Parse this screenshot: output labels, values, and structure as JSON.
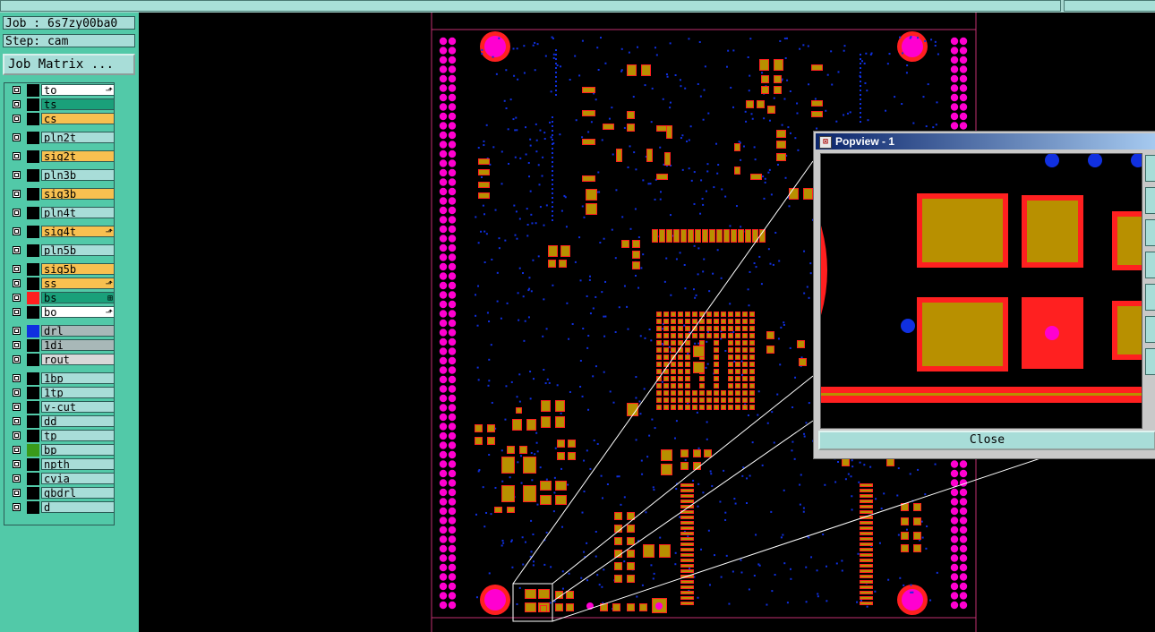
{
  "top": {
    "job": "Job : 6s7zy00ba0",
    "step": "Step: cam"
  },
  "buttons": {
    "job_matrix": "Job Matrix ..."
  },
  "layers": [
    {
      "name": "to",
      "swatch": "#000000",
      "bg": "#ffffff",
      "mark": "⬏"
    },
    {
      "name": "ts",
      "swatch": "#000000",
      "bg": "#1aa07a",
      "mark": ""
    },
    {
      "name": "cs",
      "swatch": "#000000",
      "bg": "#f8c050",
      "mark": ""
    },
    {
      "name": "pln2t",
      "swatch": "#000000",
      "bg": "#a8ddd8",
      "mark": ""
    },
    {
      "name": "sig2t",
      "swatch": "#000000",
      "bg": "#f8c050",
      "mark": ""
    },
    {
      "name": "pln3b",
      "swatch": "#000000",
      "bg": "#a8ddd8",
      "mark": ""
    },
    {
      "name": "sig3b",
      "swatch": "#000000",
      "bg": "#f8c050",
      "mark": ""
    },
    {
      "name": "pln4t",
      "swatch": "#000000",
      "bg": "#a8ddd8",
      "mark": ""
    },
    {
      "name": "sig4t",
      "swatch": "#000000",
      "bg": "#f8c050",
      "mark": "⬏"
    },
    {
      "name": "pln5b",
      "swatch": "#000000",
      "bg": "#a8ddd8",
      "mark": ""
    },
    {
      "name": "sig5b",
      "swatch": "#000000",
      "bg": "#f8c050",
      "mark": ""
    },
    {
      "name": "ss",
      "swatch": "#000000",
      "bg": "#f8c050",
      "mark": "⬏"
    },
    {
      "name": "bs",
      "swatch": "#ff2020",
      "bg": "#1aa07a",
      "mark": "⊞"
    },
    {
      "name": "bo",
      "swatch": "#000000",
      "bg": "#ffffff",
      "mark": "⬏"
    },
    {
      "name": "drl",
      "swatch": "#1030e0",
      "bg": "#a8b8b8",
      "mark": ""
    },
    {
      "name": "1di",
      "swatch": "#000000",
      "bg": "#a8b8b8",
      "mark": ""
    },
    {
      "name": "rout",
      "swatch": "#000000",
      "bg": "#d8d8d8",
      "mark": ""
    },
    {
      "name": "1bp",
      "swatch": "#000000",
      "bg": "#a8ddd8",
      "mark": ""
    },
    {
      "name": "1tp",
      "swatch": "#000000",
      "bg": "#a8ddd8",
      "mark": ""
    },
    {
      "name": "v-cut",
      "swatch": "#000000",
      "bg": "#a8ddd8",
      "mark": ""
    },
    {
      "name": "dd",
      "swatch": "#000000",
      "bg": "#a8ddd8",
      "mark": ""
    },
    {
      "name": "tp",
      "swatch": "#000000",
      "bg": "#a8ddd8",
      "mark": ""
    },
    {
      "name": "bp",
      "swatch": "#3a9a1a",
      "bg": "#a8ddd8",
      "mark": ""
    },
    {
      "name": "npth",
      "swatch": "#000000",
      "bg": "#a8ddd8",
      "mark": ""
    },
    {
      "name": "cvia",
      "swatch": "#000000",
      "bg": "#a8ddd8",
      "mark": ""
    },
    {
      "name": "gbdrl",
      "swatch": "#000000",
      "bg": "#a8ddd8",
      "mark": ""
    },
    {
      "name": "d",
      "swatch": "#000000",
      "bg": "#a8ddd8",
      "mark": ""
    }
  ],
  "popview": {
    "title": "Popview - 1",
    "close": "Close"
  },
  "colors": {
    "pad": "#b89000",
    "pad_edge": "#ff2020",
    "mount_hole": "#ff00d0",
    "via": "#1030e0",
    "board_edge": "#c03070"
  }
}
